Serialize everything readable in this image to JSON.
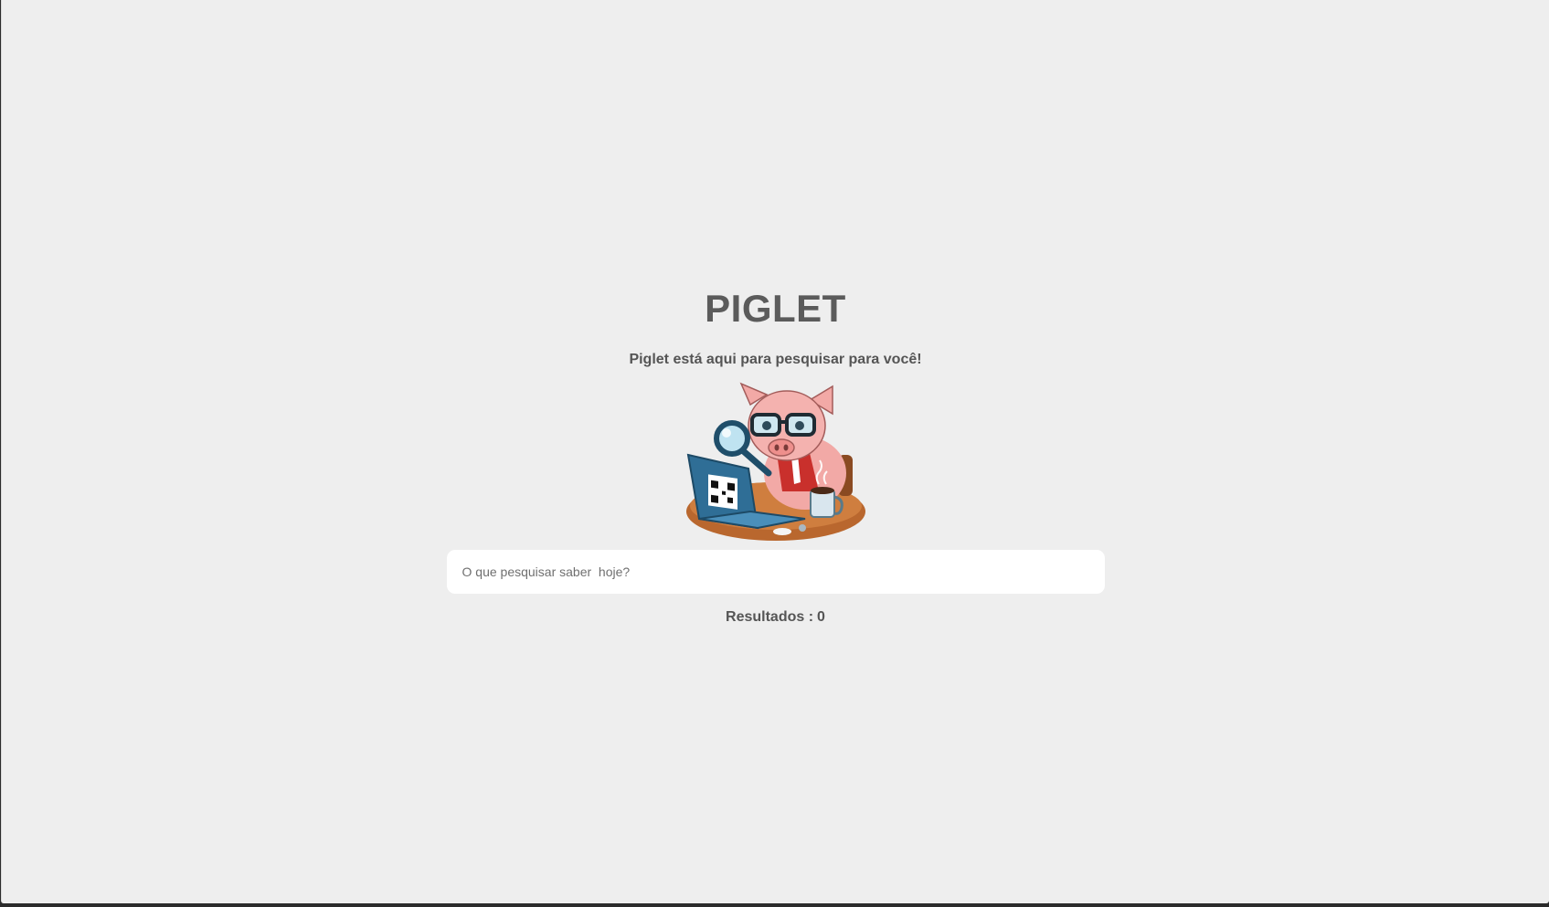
{
  "header": {
    "title": "PIGLET",
    "subtitle": "Piglet está aqui para pesquisar para você!"
  },
  "mascot": {
    "icon": "pig-detective-mascot-icon",
    "colors": {
      "pig": "#f2a9a6",
      "laptop": "#2f6e96",
      "desk": "#b9672e",
      "mug": "#d9e6ee",
      "shirt": "#c9302c"
    }
  },
  "search": {
    "placeholder": "O que pesquisar saber  hoje?",
    "value": ""
  },
  "results": {
    "label": "Resultados :",
    "count": "0"
  },
  "colors": {
    "background": "#eeeeee",
    "text": "#555555",
    "input_background": "#ffffff"
  }
}
